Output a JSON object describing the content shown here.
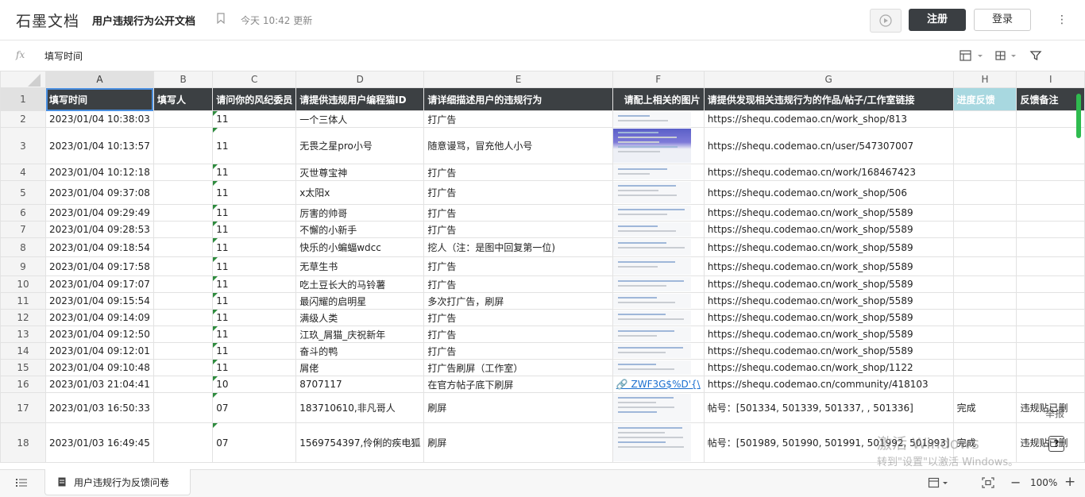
{
  "app": {
    "logo": "石墨文档",
    "doc_title": "用户违规行为公开文档",
    "updated": "今天 10:42 更新",
    "register_label": "注册",
    "login_label": "登录",
    "more_label": "⋮"
  },
  "formula": {
    "fx_label": "fx",
    "value": "填写时间"
  },
  "columns": [
    "A",
    "B",
    "C",
    "D",
    "E",
    "F",
    "G",
    "H",
    "I"
  ],
  "header_row": {
    "num": "1",
    "cells": [
      "填写时间",
      "填写人",
      "请问你的风纪委员",
      "请提供违规用户编程猫ID",
      "请详细描述用户的违规行为",
      "请配上相关的图片",
      "请提供发现相关违规行为的作品/帖子/工作室链接",
      "进度反馈",
      "反馈备注"
    ]
  },
  "rows": [
    {
      "num": "2",
      "a": "2023/01/04 10:38:03",
      "b": "",
      "c": "11",
      "d": "一个三体人",
      "e": "打广告",
      "f": "img",
      "g": "https://shequ.codemao.cn/work_shop/813",
      "h": "",
      "i": ""
    },
    {
      "num": "3",
      "a": "2023/01/04 10:13:57",
      "b": "",
      "c": "11",
      "d": "无畏之星pro小号",
      "e": "随意谩骂，冒充他人小号",
      "f": "img-dark",
      "g": "https://shequ.codemao.cn/user/547307007",
      "h": "",
      "i": ""
    },
    {
      "num": "4",
      "a": "2023/01/04 10:12:18",
      "b": "",
      "c": "11",
      "d": "灭世尊宝神",
      "e": "打广告",
      "f": "img",
      "g": "https://shequ.codemao.cn/work/168467423",
      "h": "",
      "i": ""
    },
    {
      "num": "5",
      "a": "2023/01/04 09:37:08",
      "b": "",
      "c": "11",
      "d": "x太阳x",
      "e": "打广告",
      "f": "img",
      "g": "https://shequ.codemao.cn/work_shop/506",
      "h": "",
      "i": ""
    },
    {
      "num": "6",
      "a": "2023/01/04 09:29:49",
      "b": "",
      "c": "11",
      "d": "厉害的帅哥",
      "e": "打广告",
      "f": "img",
      "g": "https://shequ.codemao.cn/work_shop/5589",
      "h": "",
      "i": ""
    },
    {
      "num": "7",
      "a": "2023/01/04 09:28:53",
      "b": "",
      "c": "11",
      "d": "不懈的小新手",
      "e": "打广告",
      "f": "img",
      "g": "https://shequ.codemao.cn/work_shop/5589",
      "h": "",
      "i": ""
    },
    {
      "num": "8",
      "a": "2023/01/04 09:18:54",
      "b": "",
      "c": "11",
      "d": "快乐的小蝙蝠wdcc",
      "e": "挖人（注：是图中回复第一位)",
      "f": "img",
      "g": "https://shequ.codemao.cn/work_shop/5589",
      "h": "",
      "i": ""
    },
    {
      "num": "9",
      "a": "2023/01/04 09:17:58",
      "b": "",
      "c": "11",
      "d": "无草生书",
      "e": "打广告",
      "f": "img",
      "g": "https://shequ.codemao.cn/work_shop/5589",
      "h": "",
      "i": ""
    },
    {
      "num": "10",
      "a": "2023/01/04 09:17:07",
      "b": "",
      "c": "11",
      "d": "吃土豆长大的马铃薯",
      "e": "打广告",
      "f": "img",
      "g": "https://shequ.codemao.cn/work_shop/5589",
      "h": "",
      "i": ""
    },
    {
      "num": "11",
      "a": "2023/01/04 09:15:54",
      "b": "",
      "c": "11",
      "d": "最闪耀的启明星",
      "e": "多次打广告，刷屏",
      "f": "img",
      "g": "https://shequ.codemao.cn/work_shop/5589",
      "h": "",
      "i": ""
    },
    {
      "num": "12",
      "a": "2023/01/04 09:14:09",
      "b": "",
      "c": "11",
      "d": "满级人类",
      "e": "打广告",
      "f": "img",
      "g": "https://shequ.codemao.cn/work_shop/5589",
      "h": "",
      "i": ""
    },
    {
      "num": "13",
      "a": "2023/01/04 09:12:50",
      "b": "",
      "c": "11",
      "d": "江玖_屑猫_庆祝新年",
      "e": "打广告",
      "f": "img",
      "g": "https://shequ.codemao.cn/work_shop/5589",
      "h": "",
      "i": ""
    },
    {
      "num": "14",
      "a": "2023/01/04 09:12:01",
      "b": "",
      "c": "11",
      "d": "奋斗的鸭",
      "e": "打广告",
      "f": "img",
      "g": "https://shequ.codemao.cn/work_shop/5589",
      "h": "",
      "i": ""
    },
    {
      "num": "15",
      "a": "2023/01/04 09:10:48",
      "b": "",
      "c": "11",
      "d": "屑佬",
      "e": "打广告刷屏（工作室）",
      "f": "img",
      "g": "https://shequ.codemao.cn/work_shop/1122",
      "h": "",
      "i": ""
    },
    {
      "num": "16",
      "a": "2023/01/03 21:04:41",
      "b": "",
      "c": "10",
      "d": "8707117",
      "e": "在官方帖子底下刷屏",
      "f": "link",
      "f_text": "🔗 ZWF3G$%D'{\\",
      "g": "https://shequ.codemao.cn/community/418103",
      "h": "",
      "i": ""
    },
    {
      "num": "17",
      "a": "2023/01/03 16:50:33",
      "b": "",
      "c": "07",
      "d": "183710610,非凡哥人",
      "e": "刷屏",
      "f": "img",
      "g": "帖号：[501334, 501339, 501337, , 501336]",
      "h": "完成",
      "i": "违规贴已删"
    },
    {
      "num": "18",
      "a": "2023/01/03 16:49:45",
      "b": "",
      "c": "07",
      "d": "1569754397,伶俐的疾电狐",
      "e": "刷屏",
      "f": "img",
      "g": "帖号：[501989, 501990, 501991, 501992, 501993]",
      "h": "完成",
      "i": "违规贴已删"
    }
  ],
  "side": {
    "report_label": "举报",
    "help_label": "?"
  },
  "watermark": {
    "line1": "激活 Windows",
    "line2": "转到\"设置\"以激活 Windows。"
  },
  "bottom": {
    "sheet_tab_label": "用户违规行为反馈问卷",
    "zoom_minus": "−",
    "zoom_value": "100%",
    "zoom_plus": "+"
  },
  "colors": {
    "header_bg": "#3c4043",
    "highlight_col": "#a8d8e0",
    "triangle_marker": "#2e8b3e",
    "scrollbar": "#2fbb4f",
    "selection": "#4a8fe0"
  }
}
